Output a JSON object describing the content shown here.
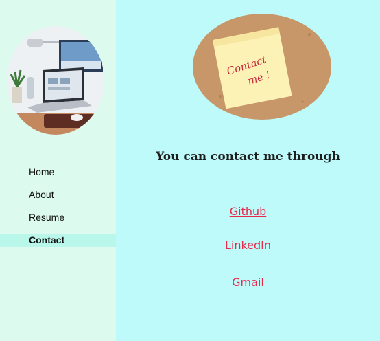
{
  "sidebar": {
    "nav_items": [
      "Home",
      "About",
      "Resume",
      "Contact"
    ],
    "active_item": "Contact"
  },
  "main": {
    "sticky_note_text": "Contact me !",
    "heading": "You can contact me through",
    "links": [
      "Github",
      "LinkedIn",
      "Gmail"
    ]
  },
  "colors": {
    "sidebar_bg": "#dcfaee",
    "main_bg": "#befafa",
    "active_nav_bg": "#b8f7ea",
    "link": "#e8294a",
    "note_ink": "#c8283c"
  }
}
